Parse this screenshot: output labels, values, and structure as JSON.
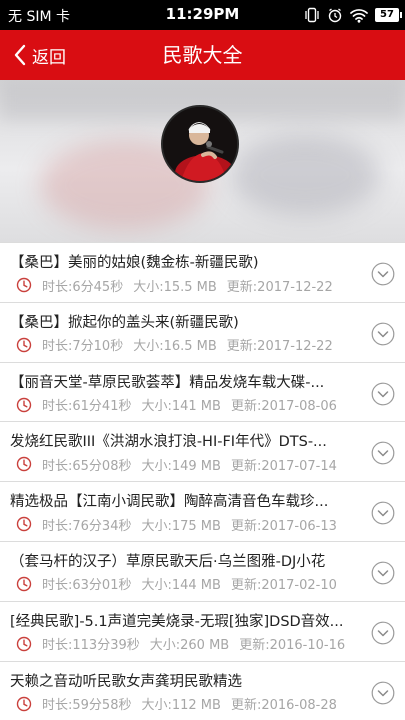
{
  "status_bar": {
    "carrier": "无 SIM 卡",
    "time": "11:29PM",
    "battery": "57",
    "icons": [
      "vibrate-icon",
      "alarm-icon",
      "wifi-icon",
      "battery-icon"
    ]
  },
  "nav": {
    "back_label": "返回",
    "title": "民歌大全"
  },
  "colors": {
    "accent": "#d90d12",
    "meta_text": "#a6a6a6",
    "clock": "#c9403c"
  },
  "songs": [
    {
      "title": "【桑巴】美丽的姑娘(魏金栋-新疆民歌)",
      "duration": "时长:6分45秒",
      "size": "大小:15.5 MB",
      "updated": "更新:2017-12-22"
    },
    {
      "title": "【桑巴】掀起你的盖头来(新疆民歌)",
      "duration": "时长:7分10秒",
      "size": "大小:16.5 MB",
      "updated": "更新:2017-12-22"
    },
    {
      "title": "【丽音天堂-草原民歌荟萃】精品发烧车载大碟-...",
      "duration": "时长:61分41秒",
      "size": "大小:141 MB",
      "updated": "更新:2017-08-06"
    },
    {
      "title": "发烧红民歌III《洪湖水浪打浪-HI-FI年代》DTS-...",
      "duration": "时长:65分08秒",
      "size": "大小:149 MB",
      "updated": "更新:2017-07-14"
    },
    {
      "title": "精选极品【江南小调民歌】陶醉高清音色车载珍...",
      "duration": "时长:76分34秒",
      "size": "大小:175 MB",
      "updated": "更新:2017-06-13"
    },
    {
      "title": "（套马杆的汉子）草原民歌天后·乌兰图雅-DJ小花",
      "duration": "时长:63分01秒",
      "size": "大小:144 MB",
      "updated": "更新:2017-02-10"
    },
    {
      "title": "[经典民歌]-5.1声道完美烧录-无瑕[独家]DSD音效...",
      "duration": "时长:113分39秒",
      "size": "大小:260 MB",
      "updated": "更新:2016-10-16"
    },
    {
      "title": "天赖之音动听民歌女声龚玥民歌精选",
      "duration": "时长:59分58秒",
      "size": "大小:112 MB",
      "updated": "更新:2016-08-28"
    }
  ]
}
